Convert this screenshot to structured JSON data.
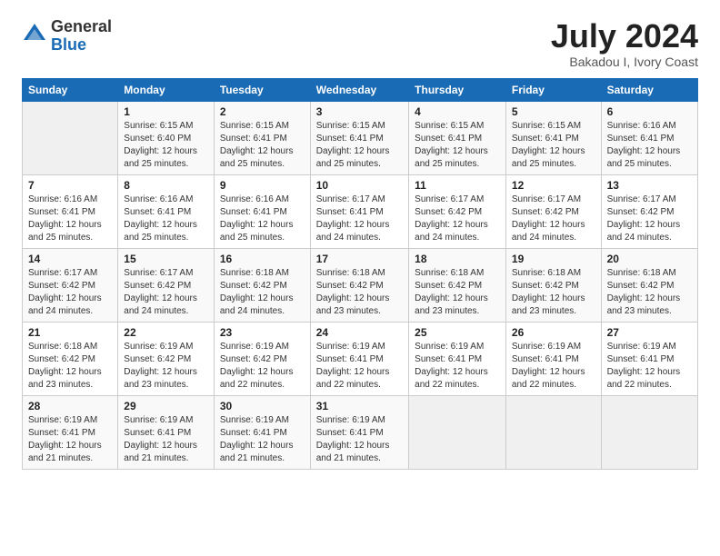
{
  "logo": {
    "general": "General",
    "blue": "Blue"
  },
  "header": {
    "month": "July 2024",
    "location": "Bakadou I, Ivory Coast"
  },
  "weekdays": [
    "Sunday",
    "Monday",
    "Tuesday",
    "Wednesday",
    "Thursday",
    "Friday",
    "Saturday"
  ],
  "weeks": [
    [
      {
        "day": "",
        "info": ""
      },
      {
        "day": "1",
        "info": "Sunrise: 6:15 AM\nSunset: 6:40 PM\nDaylight: 12 hours\nand 25 minutes."
      },
      {
        "day": "2",
        "info": "Sunrise: 6:15 AM\nSunset: 6:41 PM\nDaylight: 12 hours\nand 25 minutes."
      },
      {
        "day": "3",
        "info": "Sunrise: 6:15 AM\nSunset: 6:41 PM\nDaylight: 12 hours\nand 25 minutes."
      },
      {
        "day": "4",
        "info": "Sunrise: 6:15 AM\nSunset: 6:41 PM\nDaylight: 12 hours\nand 25 minutes."
      },
      {
        "day": "5",
        "info": "Sunrise: 6:15 AM\nSunset: 6:41 PM\nDaylight: 12 hours\nand 25 minutes."
      },
      {
        "day": "6",
        "info": "Sunrise: 6:16 AM\nSunset: 6:41 PM\nDaylight: 12 hours\nand 25 minutes."
      }
    ],
    [
      {
        "day": "7",
        "info": "Sunrise: 6:16 AM\nSunset: 6:41 PM\nDaylight: 12 hours\nand 25 minutes."
      },
      {
        "day": "8",
        "info": "Sunrise: 6:16 AM\nSunset: 6:41 PM\nDaylight: 12 hours\nand 25 minutes."
      },
      {
        "day": "9",
        "info": "Sunrise: 6:16 AM\nSunset: 6:41 PM\nDaylight: 12 hours\nand 25 minutes."
      },
      {
        "day": "10",
        "info": "Sunrise: 6:17 AM\nSunset: 6:41 PM\nDaylight: 12 hours\nand 24 minutes."
      },
      {
        "day": "11",
        "info": "Sunrise: 6:17 AM\nSunset: 6:42 PM\nDaylight: 12 hours\nand 24 minutes."
      },
      {
        "day": "12",
        "info": "Sunrise: 6:17 AM\nSunset: 6:42 PM\nDaylight: 12 hours\nand 24 minutes."
      },
      {
        "day": "13",
        "info": "Sunrise: 6:17 AM\nSunset: 6:42 PM\nDaylight: 12 hours\nand 24 minutes."
      }
    ],
    [
      {
        "day": "14",
        "info": "Sunrise: 6:17 AM\nSunset: 6:42 PM\nDaylight: 12 hours\nand 24 minutes."
      },
      {
        "day": "15",
        "info": "Sunrise: 6:17 AM\nSunset: 6:42 PM\nDaylight: 12 hours\nand 24 minutes."
      },
      {
        "day": "16",
        "info": "Sunrise: 6:18 AM\nSunset: 6:42 PM\nDaylight: 12 hours\nand 24 minutes."
      },
      {
        "day": "17",
        "info": "Sunrise: 6:18 AM\nSunset: 6:42 PM\nDaylight: 12 hours\nand 23 minutes."
      },
      {
        "day": "18",
        "info": "Sunrise: 6:18 AM\nSunset: 6:42 PM\nDaylight: 12 hours\nand 23 minutes."
      },
      {
        "day": "19",
        "info": "Sunrise: 6:18 AM\nSunset: 6:42 PM\nDaylight: 12 hours\nand 23 minutes."
      },
      {
        "day": "20",
        "info": "Sunrise: 6:18 AM\nSunset: 6:42 PM\nDaylight: 12 hours\nand 23 minutes."
      }
    ],
    [
      {
        "day": "21",
        "info": "Sunrise: 6:18 AM\nSunset: 6:42 PM\nDaylight: 12 hours\nand 23 minutes."
      },
      {
        "day": "22",
        "info": "Sunrise: 6:19 AM\nSunset: 6:42 PM\nDaylight: 12 hours\nand 23 minutes."
      },
      {
        "day": "23",
        "info": "Sunrise: 6:19 AM\nSunset: 6:42 PM\nDaylight: 12 hours\nand 22 minutes."
      },
      {
        "day": "24",
        "info": "Sunrise: 6:19 AM\nSunset: 6:41 PM\nDaylight: 12 hours\nand 22 minutes."
      },
      {
        "day": "25",
        "info": "Sunrise: 6:19 AM\nSunset: 6:41 PM\nDaylight: 12 hours\nand 22 minutes."
      },
      {
        "day": "26",
        "info": "Sunrise: 6:19 AM\nSunset: 6:41 PM\nDaylight: 12 hours\nand 22 minutes."
      },
      {
        "day": "27",
        "info": "Sunrise: 6:19 AM\nSunset: 6:41 PM\nDaylight: 12 hours\nand 22 minutes."
      }
    ],
    [
      {
        "day": "28",
        "info": "Sunrise: 6:19 AM\nSunset: 6:41 PM\nDaylight: 12 hours\nand 21 minutes."
      },
      {
        "day": "29",
        "info": "Sunrise: 6:19 AM\nSunset: 6:41 PM\nDaylight: 12 hours\nand 21 minutes."
      },
      {
        "day": "30",
        "info": "Sunrise: 6:19 AM\nSunset: 6:41 PM\nDaylight: 12 hours\nand 21 minutes."
      },
      {
        "day": "31",
        "info": "Sunrise: 6:19 AM\nSunset: 6:41 PM\nDaylight: 12 hours\nand 21 minutes."
      },
      {
        "day": "",
        "info": ""
      },
      {
        "day": "",
        "info": ""
      },
      {
        "day": "",
        "info": ""
      }
    ]
  ]
}
